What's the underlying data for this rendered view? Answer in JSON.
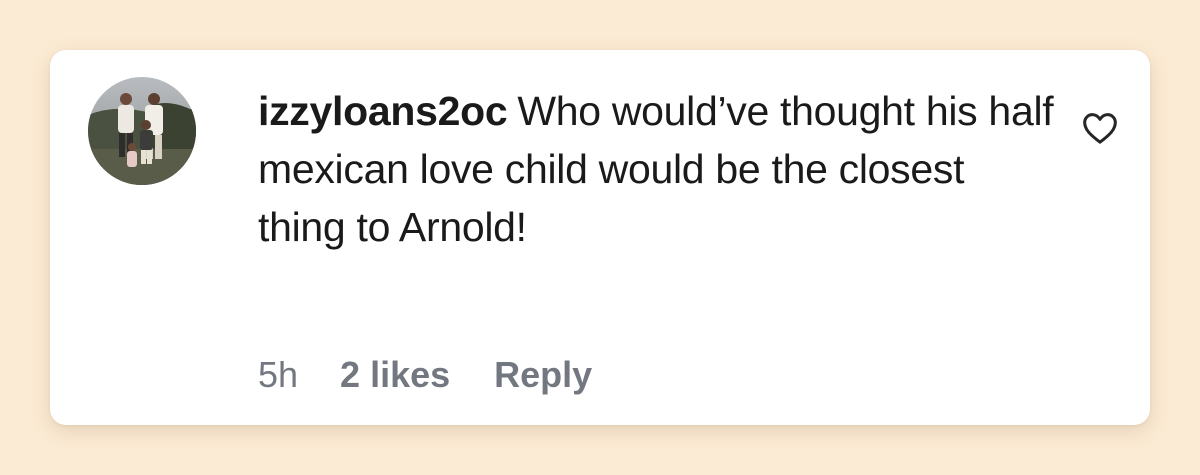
{
  "comment": {
    "username": "izzyloans2oc",
    "text": "Who would’ve thought his half mexican love child would be the closest thing to Arnold!",
    "time": "5h",
    "likes": "2 likes",
    "reply_label": "Reply"
  },
  "icons": {
    "like": "heart-outline-icon",
    "avatar": "profile-photo"
  },
  "colors": {
    "background": "#fcebd4",
    "card": "#ffffff",
    "text": "#1a1a1a",
    "meta": "#737780"
  }
}
